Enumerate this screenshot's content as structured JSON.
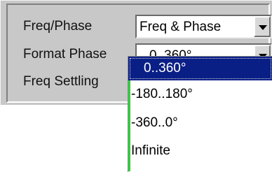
{
  "rows": [
    {
      "label": "Freq/Phase",
      "value": "Freq & Phase"
    },
    {
      "label": "Format Phase",
      "value": "0..360°"
    },
    {
      "label": "Freq Settling"
    }
  ],
  "dropdown": {
    "options": [
      "0..360°",
      "-180..180°",
      "-360..0°",
      "Infinite"
    ],
    "selected_index": 0
  },
  "colors": {
    "panel": "#c8c8c8",
    "selection": "#0a1f86",
    "focus_line": "#2fd13a"
  }
}
